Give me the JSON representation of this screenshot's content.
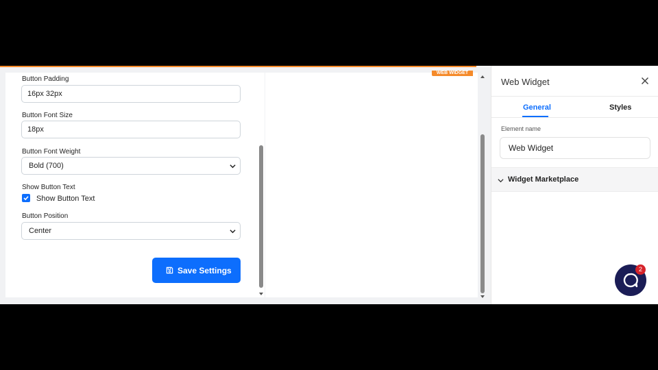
{
  "form": {
    "button_padding": {
      "label": "Button Padding",
      "value": "16px 32px"
    },
    "button_font_size": {
      "label": "Button Font Size",
      "value": "18px"
    },
    "button_font_weight": {
      "label": "Button Font Weight",
      "value": "Bold (700)"
    },
    "show_button_text": {
      "label": "Show Button Text",
      "checkbox_label": "Show Button Text",
      "checked": true
    },
    "button_position": {
      "label": "Button Position",
      "value": "Center"
    },
    "save_label": "Save Settings"
  },
  "preview": {
    "badge": "WEB WIDGET"
  },
  "sidebar": {
    "title": "Web Widget",
    "tabs": [
      {
        "label": "General",
        "active": true
      },
      {
        "label": "Styles",
        "active": false
      }
    ],
    "element_name_label": "Element name",
    "element_name_value": "Web Widget",
    "accordion_label": "Widget Marketplace"
  },
  "chat": {
    "badge_count": "2"
  },
  "colors": {
    "accent": "#0d6efd",
    "orange": "#f58a2a",
    "chat": "#1b1d56",
    "badge": "#d6232a"
  },
  "icons": [
    "chevron-down-icon",
    "check-icon",
    "save-icon",
    "close-icon",
    "chat-icon"
  ]
}
